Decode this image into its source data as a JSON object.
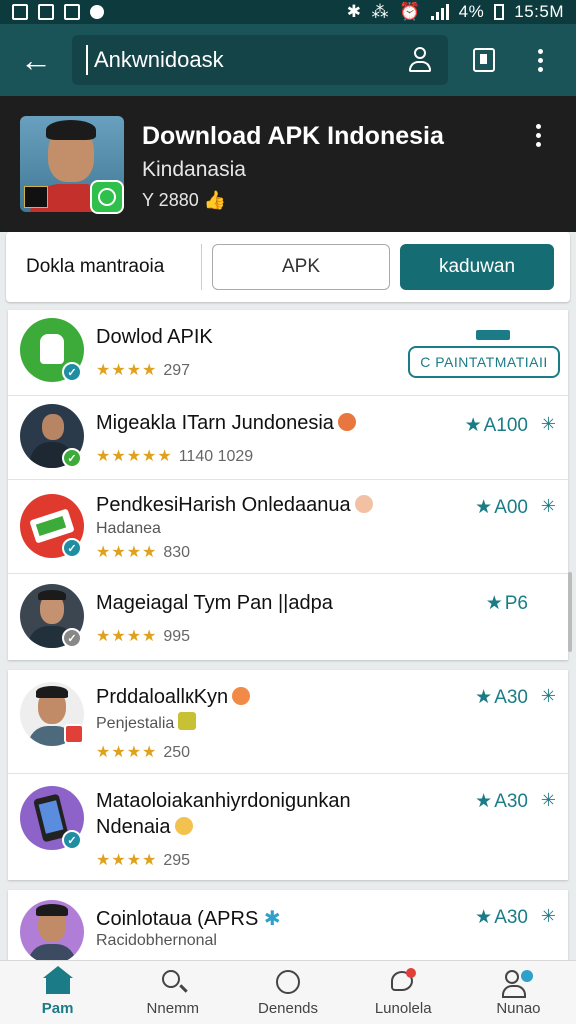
{
  "status_bar": {
    "battery": "4%",
    "time": "15:5M"
  },
  "toolbar": {
    "search_value": "Ankwnidoask"
  },
  "profile": {
    "title": "Download APK Indonesia",
    "subtitle": "Kindanasia",
    "count": "Y 2880"
  },
  "tabs": [
    {
      "label": "Dokla mantraoia"
    },
    {
      "label": "APK"
    },
    {
      "label": "kaduwan"
    }
  ],
  "list": [
    {
      "title": "Dowlod APIK",
      "subtitle": "",
      "stars": "★★★★",
      "rating": "297",
      "action": "C PAINTATMATIAII",
      "score": "",
      "avatar": "app-green-icon"
    },
    {
      "title": "Migeakla ITarn Jundonesia",
      "subtitle": "",
      "stars": "★★★★★",
      "rating": "1140 1029",
      "action": "",
      "score": "A100",
      "avatar": "person"
    },
    {
      "title": "PendkesiHarish Onledaanua",
      "subtitle": "Hadanea",
      "stars": "★★★★",
      "rating": "830",
      "action": "",
      "score": "A00",
      "avatar": "app-red-icon"
    },
    {
      "title": "Mageiagal Tym Pan ||adpa",
      "subtitle": "",
      "stars": "★★★★",
      "rating": "995",
      "action": "",
      "score": "P6",
      "avatar": "person"
    },
    {
      "title": "PrddaloallкKyn",
      "subtitle": "Penjestalia",
      "stars": "★★★★",
      "rating": "250",
      "action": "",
      "score": "A30",
      "avatar": "person"
    },
    {
      "title": "Mataoloiakanhiyrdonigunkan",
      "subtitle": "Ndenaia",
      "stars": "★★★★",
      "rating": "295",
      "action": "",
      "score": "A30",
      "avatar": "phone-app-icon"
    },
    {
      "title": "Cοinlotaua (APRS",
      "subtitle": "Racidobhernonal",
      "stars": "",
      "rating": "",
      "action": "",
      "score": "A30",
      "avatar": "person"
    }
  ],
  "bottom_nav": [
    {
      "label": "Pam",
      "active": true
    },
    {
      "label": "Nnemm"
    },
    {
      "label": "Denends"
    },
    {
      "label": "Lunolela"
    },
    {
      "label": "Nunao"
    }
  ],
  "colors": {
    "toolbar": "#1a5358",
    "accent": "#1b7c87",
    "stars": "#e0a21e",
    "header": "#1e1e1e"
  }
}
